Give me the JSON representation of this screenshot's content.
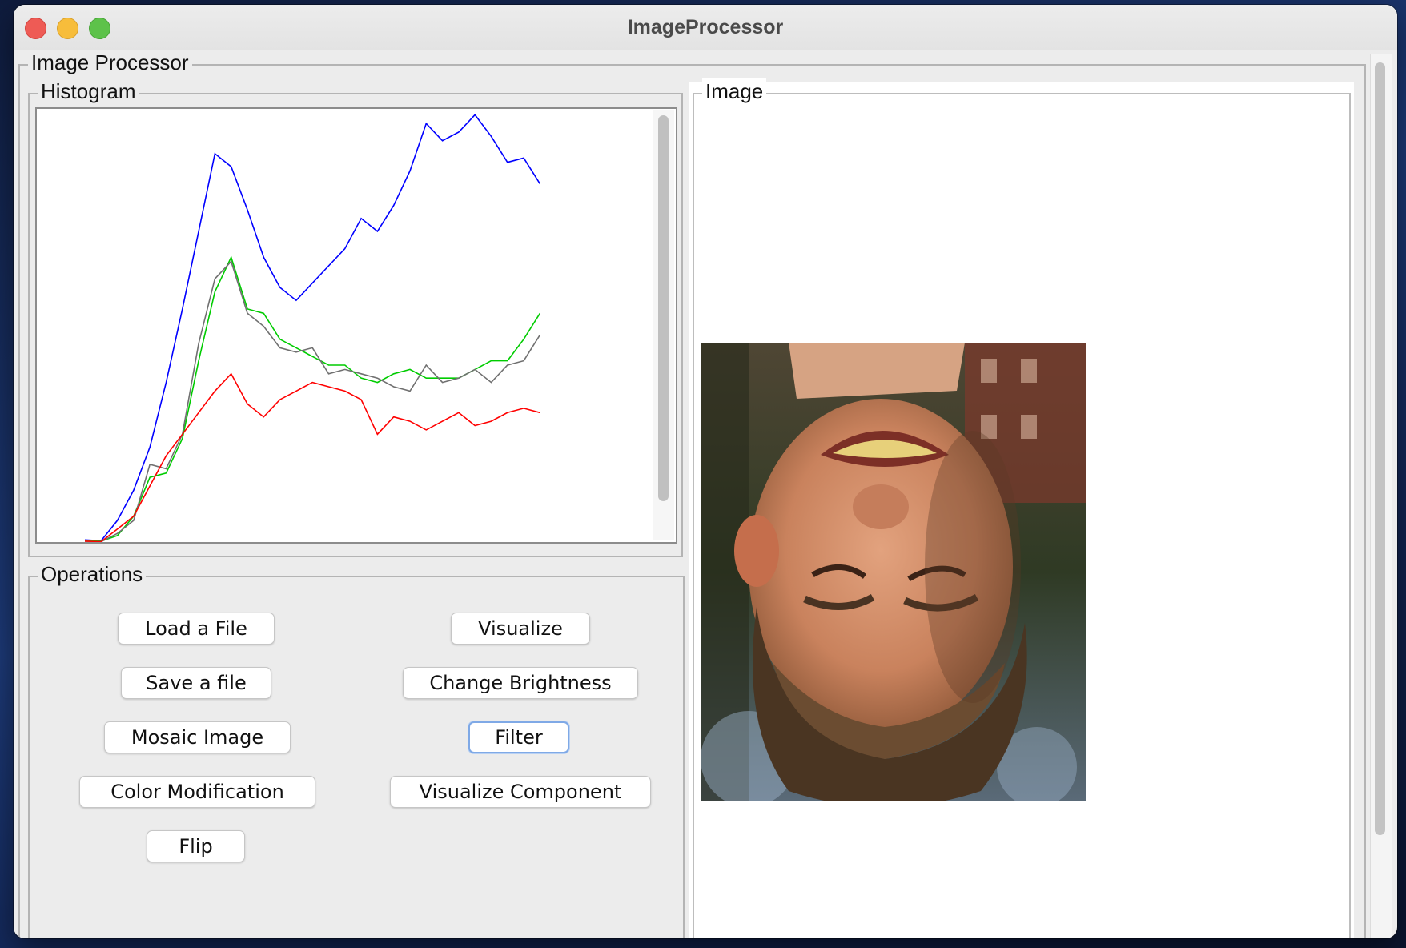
{
  "window": {
    "title": "ImageProcessor"
  },
  "main_panel": {
    "label": "Image Processor"
  },
  "histogram": {
    "label": "Histogram"
  },
  "operations": {
    "label": "Operations",
    "buttons": {
      "load_file": "Load a File",
      "visualize": "Visualize",
      "save_file": "Save a file",
      "change_brightness": "Change Brightness",
      "mosaic_image": "Mosaic Image",
      "filter": "Filter",
      "color_modification": "Color Modification",
      "visualize_component": "Visualize Component",
      "flip": "Flip"
    }
  },
  "image_panel": {
    "label": "Image"
  },
  "chart_data": {
    "type": "line",
    "x": [
      0,
      1,
      2,
      3,
      4,
      5,
      6,
      7,
      8,
      9,
      10,
      11,
      12,
      13,
      14,
      15,
      16,
      17,
      18,
      19,
      20,
      21,
      22,
      23,
      24,
      25,
      26,
      27,
      28
    ],
    "ylim": [
      0,
      100
    ],
    "grid": false,
    "series": [
      {
        "color": "#0000ff",
        "values": [
          0.5,
          0.3,
          5,
          12,
          22,
          37,
          54,
          72,
          90,
          87,
          77,
          66,
          59,
          56,
          60,
          64,
          68,
          75,
          72,
          78,
          86,
          97,
          93,
          95,
          99,
          94,
          88,
          89,
          83
        ]
      },
      {
        "color": "#00cc00",
        "values": [
          0.3,
          0.2,
          1.5,
          6,
          15,
          16,
          24,
          42,
          58,
          66,
          54,
          53,
          47,
          45,
          43,
          41,
          41,
          38,
          37,
          39,
          40,
          38,
          38,
          38,
          40,
          42,
          42,
          47,
          53
        ]
      },
      {
        "color": "#707070",
        "values": [
          0.2,
          0.1,
          2,
          5,
          18,
          17,
          25,
          46,
          61,
          65,
          53,
          50,
          45,
          44,
          45,
          39,
          40,
          39,
          38,
          36,
          35,
          41,
          37,
          38,
          40,
          37,
          41,
          42,
          48
        ]
      },
      {
        "color": "#ff0000",
        "values": [
          0.2,
          0.1,
          3,
          6,
          13,
          20,
          25,
          30,
          35,
          39,
          32,
          29,
          33,
          35,
          37,
          36,
          35,
          33,
          25,
          29,
          28,
          26,
          28,
          30,
          27,
          28,
          30,
          31,
          30
        ]
      }
    ]
  }
}
